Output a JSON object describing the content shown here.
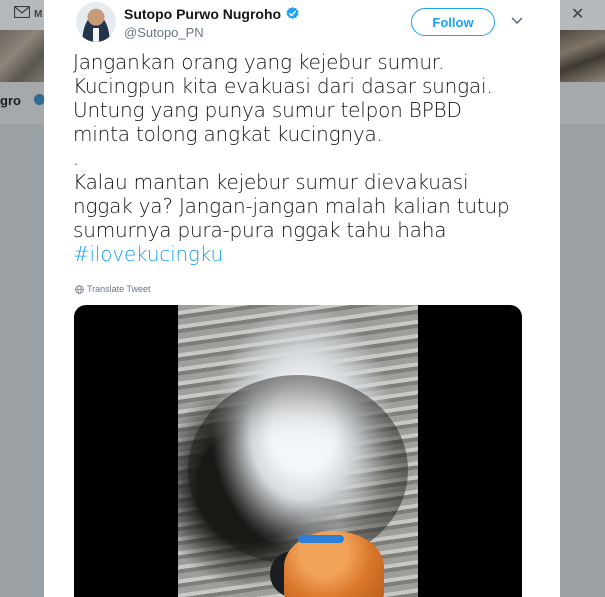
{
  "background": {
    "mail_label": "M",
    "left_name": "gro",
    "close_glyph": "✕"
  },
  "tweet": {
    "display_name": "Sutopo Purwo Nugroho",
    "handle": "@Sutopo_PN",
    "follow_label": "Follow",
    "text_lines": "Jangankan orang yang kejebur sumur.\nKucingpun kita evakuasi dari dasar sungai.\nUntung yang punya sumur telpon BPBD\nminta tolong angkat kucingnya.\n.\nKalau mantan kejebur sumur dievakuasi\nnggak ya? Jangan-jangan malah kalian tutup\nsumurnya pura-pura nggak tahu haha",
    "hashtag": "#ilovekucingku",
    "translate_label": "Translate Tweet",
    "icons": {
      "verified": "verified-icon",
      "caret": "chevron-down-icon",
      "globe": "globe-icon",
      "mail": "envelope-icon"
    },
    "colors": {
      "accent": "#1da1f2",
      "text": "#14171a",
      "muted": "#657786"
    }
  }
}
